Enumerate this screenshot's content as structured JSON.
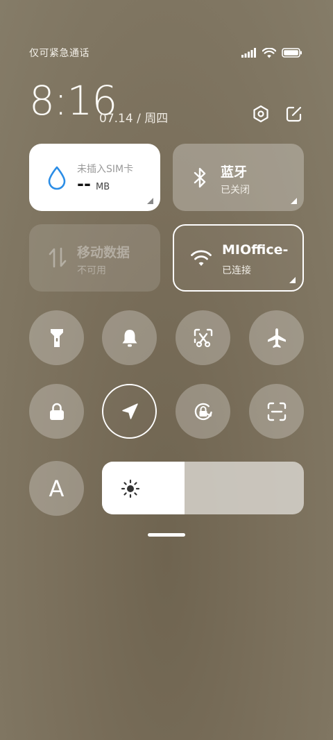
{
  "status_bar": {
    "carrier": "仅可紧急通话"
  },
  "header": {
    "time": "8:16",
    "date": "07.14 / 周四"
  },
  "tiles": {
    "data_usage": {
      "title": "未插入SIM卡",
      "value": "--",
      "unit": "MB",
      "icon": "water-drop-icon"
    },
    "bluetooth": {
      "title": "蓝牙",
      "status": "已关闭",
      "icon": "bluetooth-icon"
    },
    "mobile_data": {
      "title": "移动数据",
      "status": "不可用",
      "icon": "data-arrows-icon"
    },
    "wifi": {
      "title": "MIOffice-",
      "status": "已连接",
      "icon": "wifi-icon"
    }
  },
  "toggles_row1": [
    "flashlight-icon",
    "bell-icon",
    "screenshot-icon",
    "airplane-icon"
  ],
  "toggles_row2": [
    "lock-icon",
    "location-icon",
    "rotation-lock-icon",
    "scan-icon"
  ],
  "auto_brightness_label": "A",
  "brightness_level": 0.41,
  "colors": {
    "accent_blue": "#2b8de6",
    "tile_white": "#ffffff",
    "background": "#7a6f5b"
  }
}
